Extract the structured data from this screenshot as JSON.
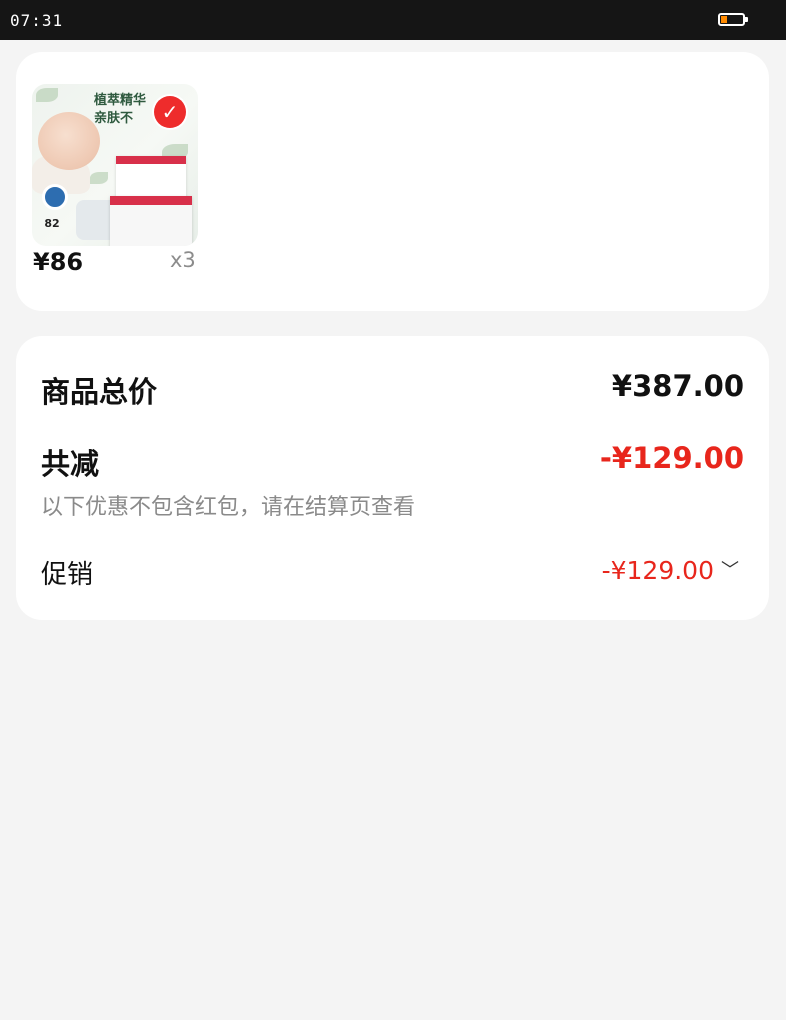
{
  "status_bar": {
    "time": "07:31",
    "battery_color": "#ff8a00"
  },
  "order": {
    "product": {
      "image_slogan_line1": "植萃精华",
      "image_slogan_line2": "亲肤不",
      "image_stat": "82",
      "price": "¥86",
      "quantity": "x3",
      "selected": true
    }
  },
  "summary": {
    "total_label": "商品总价",
    "total_value": "¥387.00",
    "discount_label": "共减",
    "discount_value": "-¥129.00",
    "discount_note": "以下优惠不包含红包，请在结算页查看",
    "promo_label": "促销",
    "promo_value": "-¥129.00",
    "promo_icon": "chevron-down-icon"
  },
  "colors": {
    "accent_red": "#e8261c",
    "page_background": "#f4f4f4",
    "card_background": "#ffffff"
  }
}
